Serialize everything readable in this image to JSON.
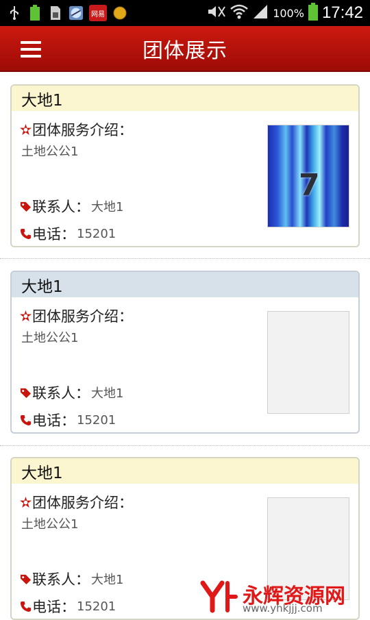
{
  "status_bar": {
    "battery": "100%",
    "time": "17:42",
    "icons": [
      "usb-icon",
      "battery-small-icon",
      "sim-icon",
      "browser-icon",
      "netease-app-icon",
      "sun-icon",
      "mute-icon",
      "wifi-icon",
      "signal-icon",
      "battery-icon"
    ],
    "netease_label": "网易"
  },
  "app_bar": {
    "title": "团体展示",
    "menu_icon": "menu-icon"
  },
  "cards": [
    {
      "name": "大地1",
      "intro_label": "团体服务介绍：",
      "intro": "土地公公1",
      "contact_label": "联系人：",
      "contact": "大地1",
      "phone_label": "电话：",
      "phone": "15201",
      "image": "photo",
      "image_glyph": "7",
      "header_color": "#fbf6cf"
    },
    {
      "name": "大地1",
      "intro_label": "团体服务介绍：",
      "intro": "土地公公1",
      "contact_label": "联系人：",
      "contact": "大地1",
      "phone_label": "电话：",
      "phone": "15201",
      "image": "empty",
      "header_color": "#d7e1ea"
    },
    {
      "name": "大地1",
      "intro_label": "团体服务介绍：",
      "intro": "土地公公1",
      "contact_label": "联系人：",
      "contact": "大地1",
      "phone_label": "电话：",
      "phone": "15201",
      "image": "empty",
      "header_color": "#fbf6cf"
    }
  ],
  "watermark": {
    "text": "永辉资源网",
    "url": "www.yhkjjj.com"
  },
  "colors": {
    "accent": "#b5120a",
    "icon_red": "#c8160d"
  }
}
